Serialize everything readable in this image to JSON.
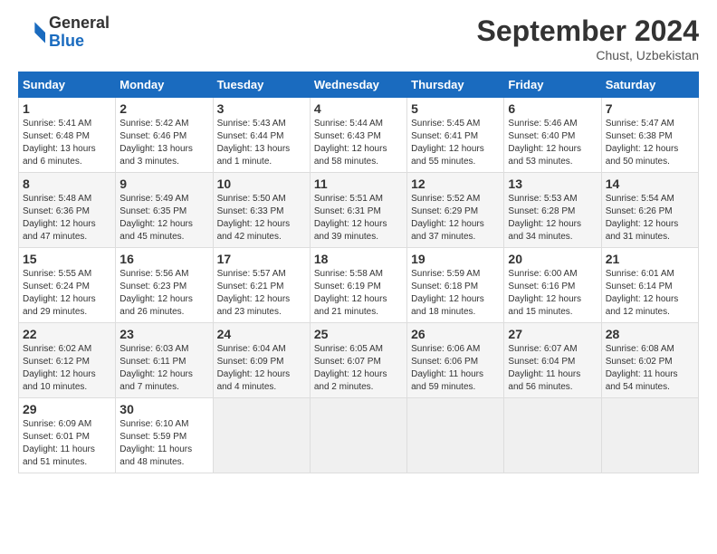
{
  "header": {
    "logo_general": "General",
    "logo_blue": "Blue",
    "title": "September 2024",
    "location": "Chust, Uzbekistan"
  },
  "days_of_week": [
    "Sunday",
    "Monday",
    "Tuesday",
    "Wednesday",
    "Thursday",
    "Friday",
    "Saturday"
  ],
  "weeks": [
    [
      {
        "day": "1",
        "sunrise": "5:41 AM",
        "sunset": "6:48 PM",
        "daylight": "13 hours and 6 minutes."
      },
      {
        "day": "2",
        "sunrise": "5:42 AM",
        "sunset": "6:46 PM",
        "daylight": "13 hours and 3 minutes."
      },
      {
        "day": "3",
        "sunrise": "5:43 AM",
        "sunset": "6:44 PM",
        "daylight": "13 hours and 1 minute."
      },
      {
        "day": "4",
        "sunrise": "5:44 AM",
        "sunset": "6:43 PM",
        "daylight": "12 hours and 58 minutes."
      },
      {
        "day": "5",
        "sunrise": "5:45 AM",
        "sunset": "6:41 PM",
        "daylight": "12 hours and 55 minutes."
      },
      {
        "day": "6",
        "sunrise": "5:46 AM",
        "sunset": "6:40 PM",
        "daylight": "12 hours and 53 minutes."
      },
      {
        "day": "7",
        "sunrise": "5:47 AM",
        "sunset": "6:38 PM",
        "daylight": "12 hours and 50 minutes."
      }
    ],
    [
      {
        "day": "8",
        "sunrise": "5:48 AM",
        "sunset": "6:36 PM",
        "daylight": "12 hours and 47 minutes."
      },
      {
        "day": "9",
        "sunrise": "5:49 AM",
        "sunset": "6:35 PM",
        "daylight": "12 hours and 45 minutes."
      },
      {
        "day": "10",
        "sunrise": "5:50 AM",
        "sunset": "6:33 PM",
        "daylight": "12 hours and 42 minutes."
      },
      {
        "day": "11",
        "sunrise": "5:51 AM",
        "sunset": "6:31 PM",
        "daylight": "12 hours and 39 minutes."
      },
      {
        "day": "12",
        "sunrise": "5:52 AM",
        "sunset": "6:29 PM",
        "daylight": "12 hours and 37 minutes."
      },
      {
        "day": "13",
        "sunrise": "5:53 AM",
        "sunset": "6:28 PM",
        "daylight": "12 hours and 34 minutes."
      },
      {
        "day": "14",
        "sunrise": "5:54 AM",
        "sunset": "6:26 PM",
        "daylight": "12 hours and 31 minutes."
      }
    ],
    [
      {
        "day": "15",
        "sunrise": "5:55 AM",
        "sunset": "6:24 PM",
        "daylight": "12 hours and 29 minutes."
      },
      {
        "day": "16",
        "sunrise": "5:56 AM",
        "sunset": "6:23 PM",
        "daylight": "12 hours and 26 minutes."
      },
      {
        "day": "17",
        "sunrise": "5:57 AM",
        "sunset": "6:21 PM",
        "daylight": "12 hours and 23 minutes."
      },
      {
        "day": "18",
        "sunrise": "5:58 AM",
        "sunset": "6:19 PM",
        "daylight": "12 hours and 21 minutes."
      },
      {
        "day": "19",
        "sunrise": "5:59 AM",
        "sunset": "6:18 PM",
        "daylight": "12 hours and 18 minutes."
      },
      {
        "day": "20",
        "sunrise": "6:00 AM",
        "sunset": "6:16 PM",
        "daylight": "12 hours and 15 minutes."
      },
      {
        "day": "21",
        "sunrise": "6:01 AM",
        "sunset": "6:14 PM",
        "daylight": "12 hours and 12 minutes."
      }
    ],
    [
      {
        "day": "22",
        "sunrise": "6:02 AM",
        "sunset": "6:12 PM",
        "daylight": "12 hours and 10 minutes."
      },
      {
        "day": "23",
        "sunrise": "6:03 AM",
        "sunset": "6:11 PM",
        "daylight": "12 hours and 7 minutes."
      },
      {
        "day": "24",
        "sunrise": "6:04 AM",
        "sunset": "6:09 PM",
        "daylight": "12 hours and 4 minutes."
      },
      {
        "day": "25",
        "sunrise": "6:05 AM",
        "sunset": "6:07 PM",
        "daylight": "12 hours and 2 minutes."
      },
      {
        "day": "26",
        "sunrise": "6:06 AM",
        "sunset": "6:06 PM",
        "daylight": "11 hours and 59 minutes."
      },
      {
        "day": "27",
        "sunrise": "6:07 AM",
        "sunset": "6:04 PM",
        "daylight": "11 hours and 56 minutes."
      },
      {
        "day": "28",
        "sunrise": "6:08 AM",
        "sunset": "6:02 PM",
        "daylight": "11 hours and 54 minutes."
      }
    ],
    [
      {
        "day": "29",
        "sunrise": "6:09 AM",
        "sunset": "6:01 PM",
        "daylight": "11 hours and 51 minutes."
      },
      {
        "day": "30",
        "sunrise": "6:10 AM",
        "sunset": "5:59 PM",
        "daylight": "11 hours and 48 minutes."
      },
      null,
      null,
      null,
      null,
      null
    ]
  ]
}
